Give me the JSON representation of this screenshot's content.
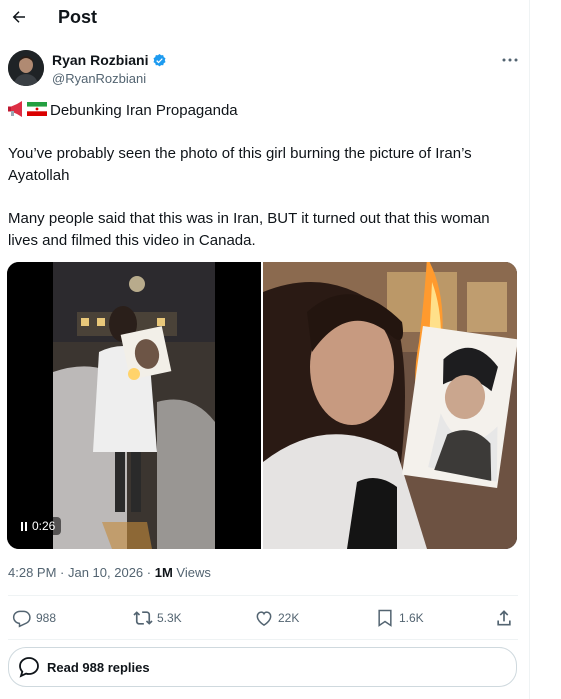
{
  "header": {
    "title": "Post",
    "back_icon": "arrow-left-icon"
  },
  "author": {
    "name": "Ryan Rozbiani",
    "handle": "@RyanRozbiani",
    "verified_color": "#1d9bf0"
  },
  "tweet": {
    "heading": "Debunking Iran Propaganda",
    "heading_icons": [
      "megaphone-icon",
      "iran-flag-icon"
    ],
    "para1_line1": "You’ve probably seen the photo of this girl burning the picture of Iran’s",
    "para1_line2": "Ayatollah",
    "para2_line1": "Many people said that this was in Iran, BUT it turned out that this woman",
    "para2_line2": "lives and filmed this video in Canada."
  },
  "media": {
    "video_time": "0:26"
  },
  "meta": {
    "time": "4:28 PM",
    "sep1": " · ",
    "date": "Jan 10, 2026",
    "sep2": " · ",
    "views": "1M",
    "views_label": " Views"
  },
  "actions": {
    "replies": "988",
    "reposts": "5.3K",
    "likes": "22K",
    "bookmarks": "1.6K"
  },
  "read_replies": "Read 988 replies",
  "colors": {
    "text": "#0f1419",
    "muted": "#536471",
    "border": "#cfd9de",
    "accent": "#1d9bf0"
  }
}
